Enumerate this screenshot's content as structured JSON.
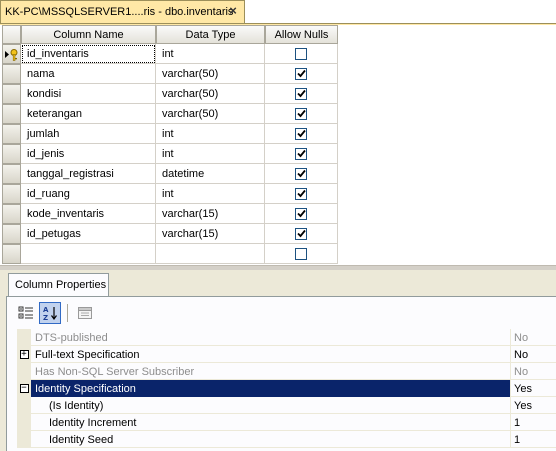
{
  "document_tab": {
    "title": "KK-PC\\MSSQLSERVER1....ris - dbo.inventaris",
    "close_glyph": "×"
  },
  "grid": {
    "headers": {
      "column_name": "Column Name",
      "data_type": "Data Type",
      "allow_nulls": "Allow Nulls"
    },
    "rows": [
      {
        "name": "id_inventaris",
        "type": "int",
        "allow_nulls": false,
        "primary_key": true
      },
      {
        "name": "nama",
        "type": "varchar(50)",
        "allow_nulls": true
      },
      {
        "name": "kondisi",
        "type": "varchar(50)",
        "allow_nulls": true
      },
      {
        "name": "keterangan",
        "type": "varchar(50)",
        "allow_nulls": true
      },
      {
        "name": "jumlah",
        "type": "int",
        "allow_nulls": true
      },
      {
        "name": "id_jenis",
        "type": "int",
        "allow_nulls": true
      },
      {
        "name": "tanggal_registrasi",
        "type": "datetime",
        "allow_nulls": true
      },
      {
        "name": "id_ruang",
        "type": "int",
        "allow_nulls": true
      },
      {
        "name": "kode_inventaris",
        "type": "varchar(15)",
        "allow_nulls": true
      },
      {
        "name": "id_petugas",
        "type": "varchar(15)",
        "allow_nulls": true
      },
      {
        "name": "",
        "type": "",
        "allow_nulls": false
      }
    ]
  },
  "properties": {
    "tab_label": "Column Properties",
    "rows": [
      {
        "name": "DTS-published",
        "value": "No",
        "dim": true,
        "expander": "",
        "sub": false,
        "selected": false
      },
      {
        "name": "Full-text Specification",
        "value": "No",
        "dim": false,
        "expander": "+",
        "sub": false,
        "selected": false
      },
      {
        "name": "Has Non-SQL Server Subscriber",
        "value": "No",
        "dim": true,
        "expander": "",
        "sub": false,
        "selected": false
      },
      {
        "name": "Identity Specification",
        "value": "Yes",
        "dim": false,
        "expander": "−",
        "sub": false,
        "selected": true
      },
      {
        "name": "(Is Identity)",
        "value": "Yes",
        "dim": false,
        "expander": "",
        "sub": true,
        "selected": false
      },
      {
        "name": "Identity Increment",
        "value": "1",
        "dim": false,
        "expander": "",
        "sub": true,
        "selected": false
      },
      {
        "name": "Identity Seed",
        "value": "1",
        "dim": false,
        "expander": "",
        "sub": true,
        "selected": false
      }
    ]
  },
  "icons": {
    "primary_key": "key-icon",
    "row_selector_arrow": "arrow-right-icon",
    "categorized": "categorized-icon",
    "alphabetical": "alphabetical-sort-icon",
    "property_pages": "property-pages-icon"
  },
  "colors": {
    "tab_active": "#ffe8a6",
    "selection": "#0a246a",
    "panel_bg": "#ece9d8"
  }
}
